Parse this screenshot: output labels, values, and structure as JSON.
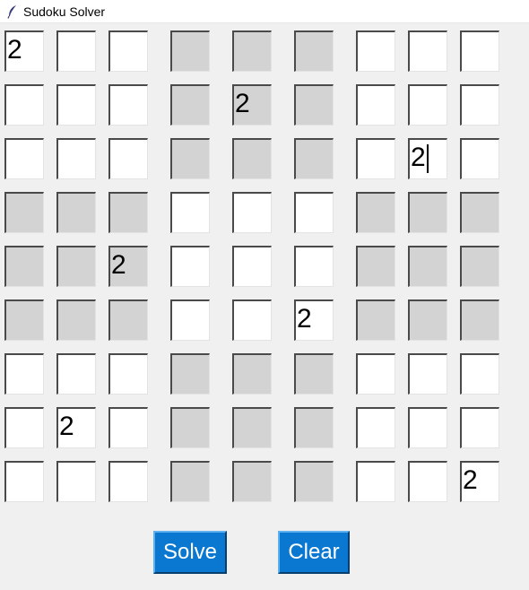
{
  "window": {
    "title": "Sudoku Solver",
    "icon": "feather-icon"
  },
  "board": {
    "cells": [
      [
        "2",
        "",
        "",
        "",
        "",
        "",
        "",
        "",
        ""
      ],
      [
        "",
        "",
        "",
        "",
        "2",
        "",
        "",
        "",
        ""
      ],
      [
        "",
        "",
        "",
        "",
        "",
        "",
        "",
        "2",
        ""
      ],
      [
        "",
        "",
        "",
        "",
        "",
        "",
        "",
        "",
        ""
      ],
      [
        "",
        "",
        "2",
        "",
        "",
        "",
        "",
        "",
        ""
      ],
      [
        "",
        "",
        "",
        "",
        "",
        "2",
        "",
        "",
        ""
      ],
      [
        "",
        "",
        "",
        "",
        "",
        "",
        "",
        "",
        ""
      ],
      [
        "",
        "2",
        "",
        "",
        "",
        "",
        "",
        "",
        ""
      ],
      [
        "",
        "",
        "",
        "",
        "",
        "",
        "",
        "",
        "2"
      ]
    ],
    "focused_cell": [
      2,
      7
    ]
  },
  "buttons": {
    "solve_label": "Solve",
    "clear_label": "Clear"
  },
  "colors": {
    "button_bg": "#0a78d0",
    "shaded_cell": "#d3d3d3",
    "cell": "#ffffff",
    "background": "#f0f0f0"
  }
}
